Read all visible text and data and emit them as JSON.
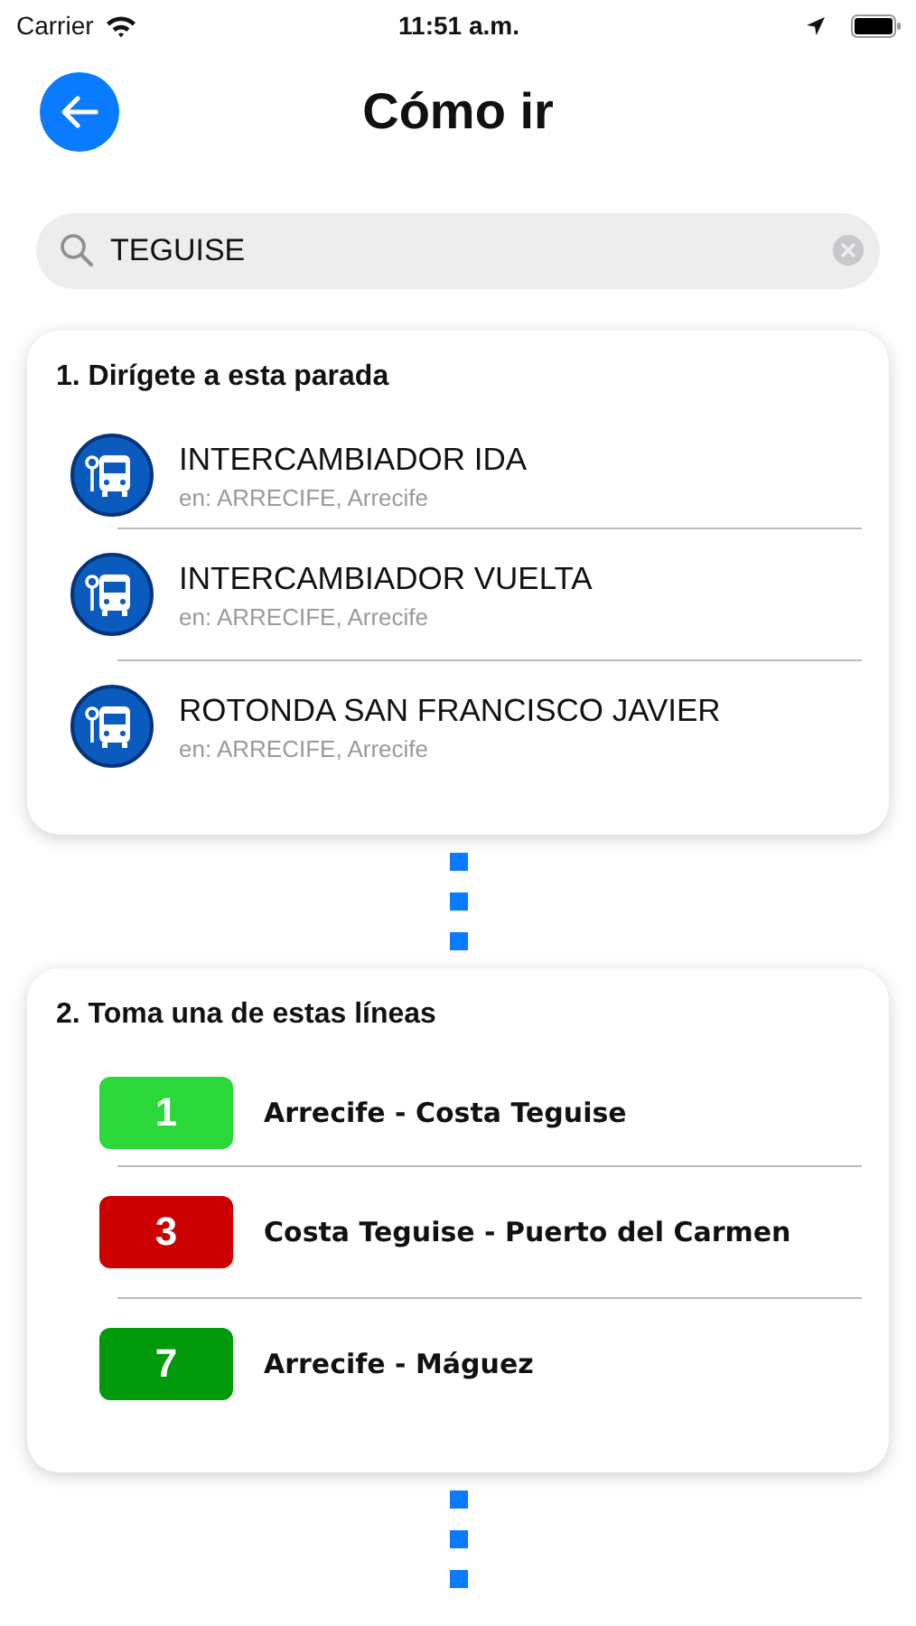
{
  "status_bar": {
    "carrier": "Carrier",
    "time": "11:51 a.m."
  },
  "header": {
    "title": "Cómo ir"
  },
  "search": {
    "value": "TEGUISE"
  },
  "steps": [
    {
      "kind": "stops",
      "title": "1. Dirígete a esta parada",
      "items": [
        {
          "name": "INTERCAMBIADOR IDA",
          "location": "en: ARRECIFE, Arrecife"
        },
        {
          "name": "INTERCAMBIADOR VUELTA",
          "location": "en: ARRECIFE, Arrecife"
        },
        {
          "name": "ROTONDA SAN FRANCISCO JAVIER",
          "location": "en: ARRECIFE, Arrecife"
        }
      ]
    },
    {
      "kind": "lines",
      "title": "2. Toma una de estas líneas",
      "items": [
        {
          "number": "1",
          "name": "Arrecife - Costa Teguise",
          "color": "#2bd83a"
        },
        {
          "number": "3",
          "name": "Costa Teguise - Puerto del Carmen",
          "color": "#cc0000"
        },
        {
          "number": "7",
          "name": "Arrecife - Máguez",
          "color": "#009a0a"
        }
      ]
    }
  ]
}
